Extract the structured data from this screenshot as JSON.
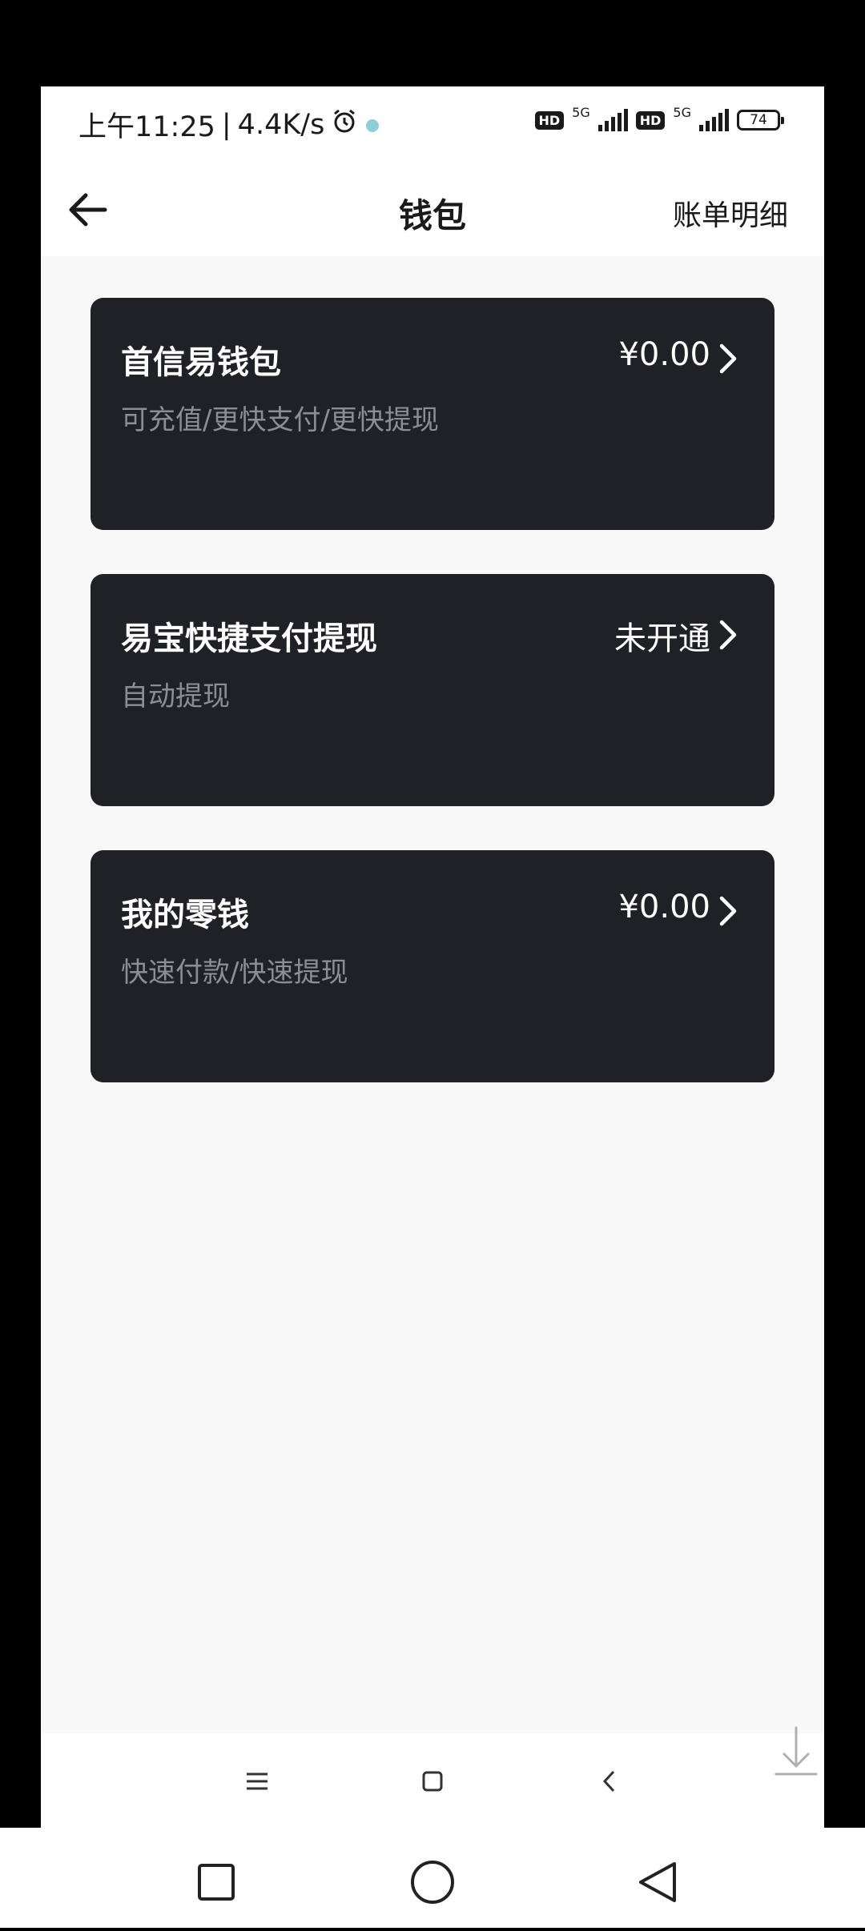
{
  "status": {
    "time": "上午11:25",
    "speed": "4.4K/s",
    "hd": "HD",
    "network": "5G",
    "battery": "74"
  },
  "header": {
    "title": "钱包",
    "bill_label": "账单明细"
  },
  "cards": [
    {
      "title": "首信易钱包",
      "subtitle": "可充值/更快支付/更快提现",
      "value": "¥0.00"
    },
    {
      "title": "易宝快捷支付提现",
      "subtitle": "自动提现",
      "value": "未开通"
    },
    {
      "title": "我的零钱",
      "subtitle": "快速付款/快速提现",
      "value": "¥0.00"
    }
  ],
  "icons": [
    "back-arrow-icon",
    "chevron-right-icon",
    "menu-icon",
    "home-icon",
    "back-icon",
    "download-icon",
    "alarm-icon"
  ],
  "colors": {
    "card_bg": "#202126",
    "page_bg": "#f9f9f9",
    "subtitle": "#8d8e94"
  }
}
